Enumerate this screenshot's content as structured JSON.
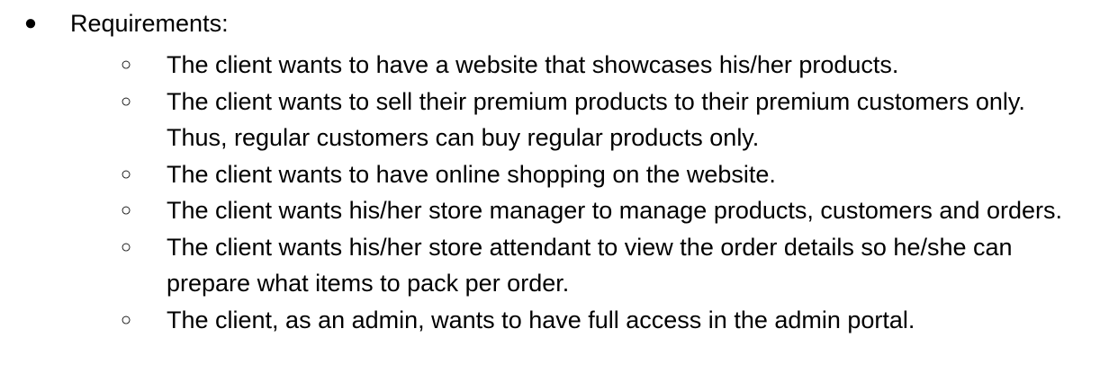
{
  "heading": {
    "bullet": "●",
    "label": "Requirements:"
  },
  "sub_bullet": "○",
  "items": [
    "The client wants to have a website that showcases his/her products.",
    "The client wants to sell their premium products to their premium customers only. Thus, regular customers can buy regular products only.",
    "The client wants to have online shopping on the website.",
    "The client wants his/her store manager to manage products, customers and orders.",
    "The client wants his/her store attendant to view the order details so he/she can prepare what items to pack per order.",
    "The client, as an admin, wants to have full access in the admin portal."
  ]
}
